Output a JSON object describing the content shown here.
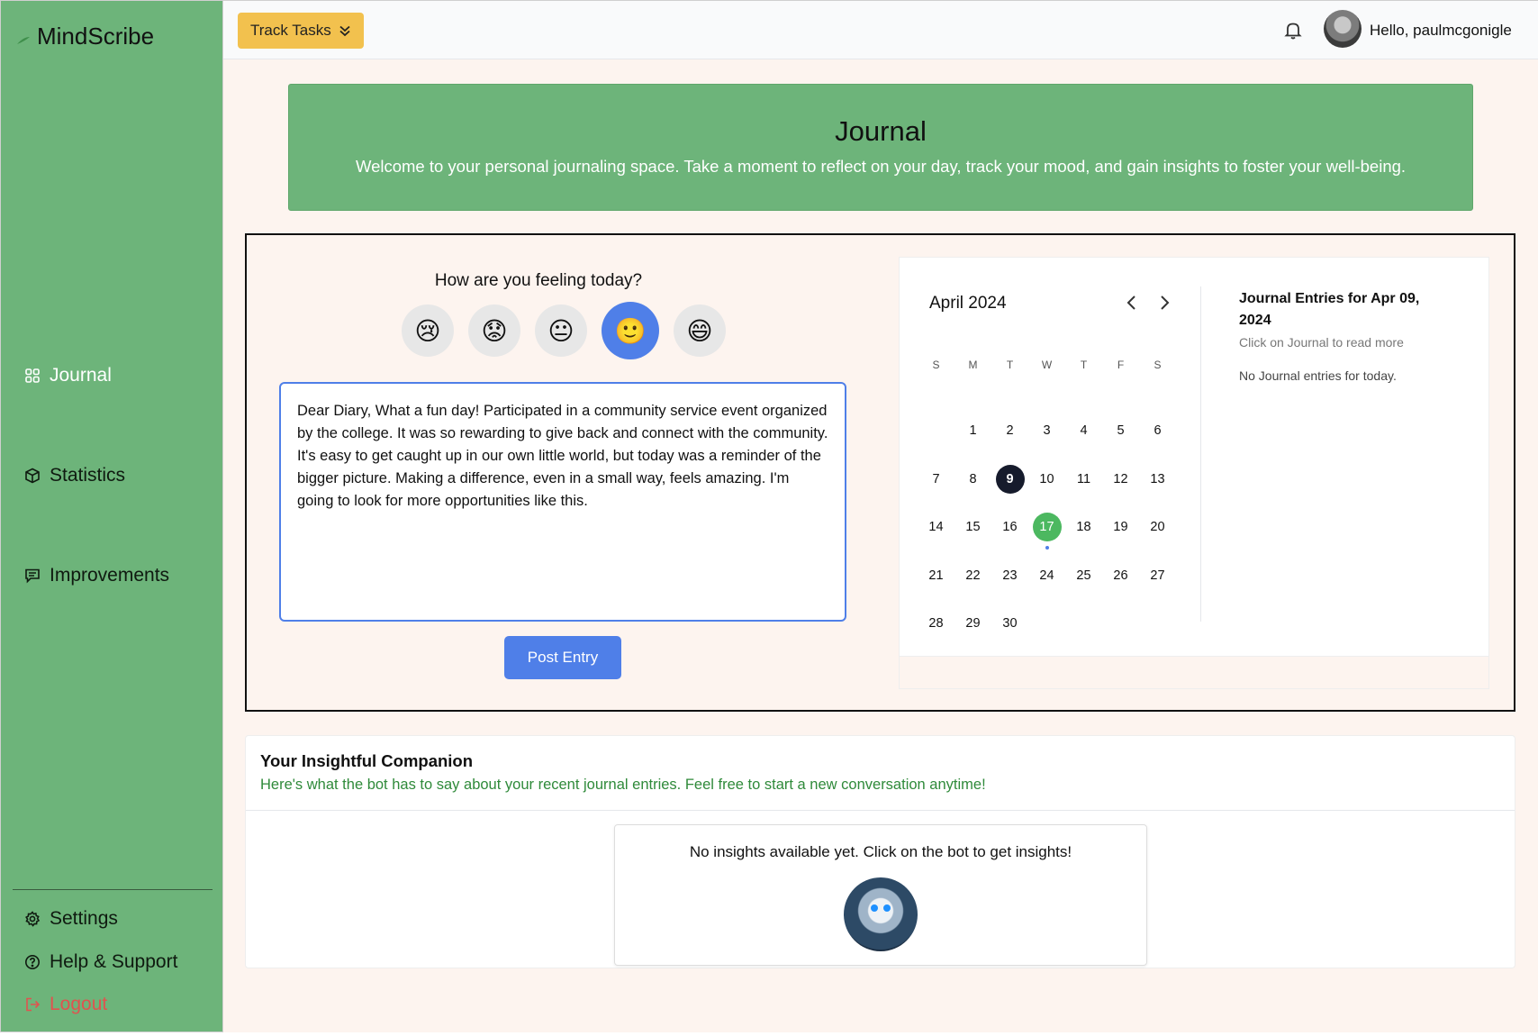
{
  "app": {
    "brand": "MindScribe",
    "colors": {
      "sidebar": "#6db47a",
      "accent": "#4f7fe8",
      "track": "#f2c14e",
      "logout": "#e0534f",
      "today": "#4cb860"
    }
  },
  "sidebar": {
    "items": [
      {
        "label": "Journal",
        "icon": "grid-icon"
      },
      {
        "label": "Statistics",
        "icon": "cube-icon"
      },
      {
        "label": "Improvements",
        "icon": "message-icon"
      }
    ],
    "bottom": [
      {
        "label": "Settings",
        "icon": "gear-icon"
      },
      {
        "label": "Help & Support",
        "icon": "question-circle-icon"
      },
      {
        "label": "Logout",
        "icon": "logout-icon"
      }
    ]
  },
  "topbar": {
    "track_label": "Track Tasks",
    "greeting": "Hello, paulmcgonigle"
  },
  "hero": {
    "title": "Journal",
    "subtitle": "Welcome to your personal journaling space. Take a moment to reflect on your day, track your mood, and gain insights to foster your well-being."
  },
  "entry": {
    "question": "How are you feeling today?",
    "moods": [
      "😢",
      "😟",
      "😐",
      "🙂",
      "😄"
    ],
    "selected_mood": 3,
    "text": "Dear Diary, What a fun day! Participated in a community service event organized by the college. It was so rewarding to give back and connect with the community. It's easy to get caught up in our own little world, but today was a reminder of the bigger picture. Making a difference, even in a small way, feels amazing. I'm going to look for more opportunities like this.",
    "post_label": "Post Entry"
  },
  "calendar": {
    "month": "April 2024",
    "weekdays": [
      "S",
      "M",
      "T",
      "W",
      "T",
      "F",
      "S"
    ],
    "first_weekday": 1,
    "days": 30,
    "selected_day": 9,
    "today": 17
  },
  "entries_panel": {
    "title": "Journal Entries for Apr 09, 2024",
    "hint": "Click on Journal to read more",
    "empty": "No Journal entries for today."
  },
  "insight": {
    "title": "Your Insightful Companion",
    "subtitle": "Here's what the bot has to say about your recent journal entries. Feel free to start a new conversation anytime!",
    "empty": "No insights available yet. Click on the bot to get insights!"
  }
}
